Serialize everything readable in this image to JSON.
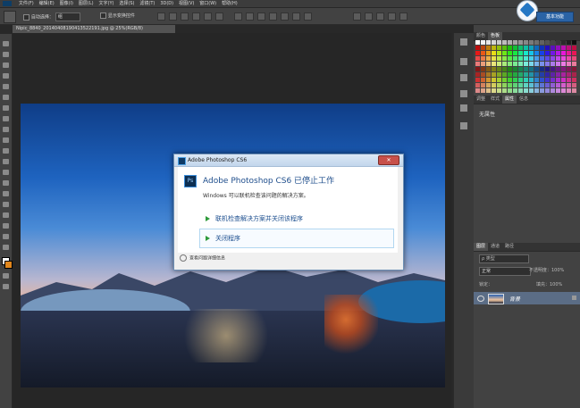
{
  "menu": {
    "items": [
      "文件(F)",
      "编辑(E)",
      "图像(I)",
      "图层(L)",
      "文字(Y)",
      "选择(S)",
      "滤镜(T)",
      "3D(D)",
      "视图(V)",
      "窗口(W)",
      "帮助(H)"
    ]
  },
  "options_bar": {
    "auto_select_label": "自动选择：",
    "auto_select_value": "组",
    "show_transform_label": "显示变换控件"
  },
  "workspace": {
    "button_label": "基本功能"
  },
  "document": {
    "tab_title": "Nipic_8840_20140408190413522191.jpg @ 25%(RGB/8)"
  },
  "dialog": {
    "title": "Adobe Photoshop CS6",
    "heading": "Adobe Photoshop CS6 已停止工作",
    "description": "Windows 可以联机检查该问题的解决方案。",
    "option1": "联机检查解决方案并关闭该程序",
    "option2": "关闭程序",
    "details": "查看问题详细信息",
    "close_glyph": "✕",
    "ps_glyph": "Ps"
  },
  "panels": {
    "color_tabs": [
      "颜色",
      "色板"
    ],
    "adjust_tabs": [
      "调整",
      "样式",
      "属性",
      "信息"
    ],
    "properties_empty": "无属性",
    "layers_tabs": [
      "图层",
      "通道",
      "路径"
    ],
    "layers_kind": "ρ 类型",
    "blend_mode": "正常",
    "opacity_label": "不透明度：100%",
    "lock_label": "锁定：",
    "fill_label": "填充：100%",
    "layer_name": "背景"
  },
  "colors": {
    "accent": "#2a63a5",
    "dialog_title": "#1f4e8c",
    "layer_selected": "#5b6d86"
  }
}
